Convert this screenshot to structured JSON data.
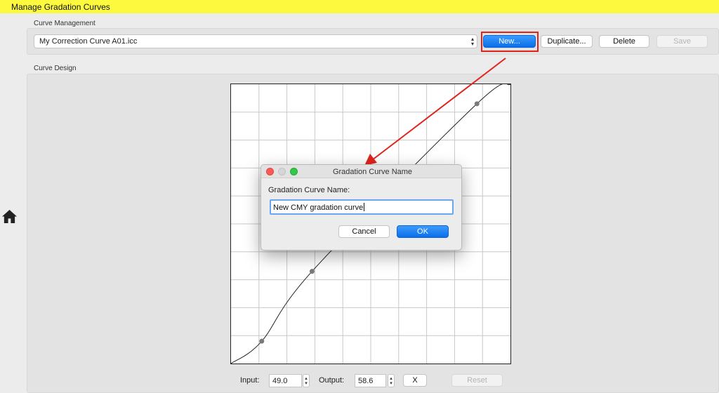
{
  "window": {
    "title": "Manage Gradation Curves"
  },
  "sidebar": {
    "home_icon": "home-icon"
  },
  "curve_management": {
    "section_label": "Curve Management",
    "selected_curve": "My Correction Curve A01.icc",
    "buttons": {
      "new": "New...",
      "duplicate": "Duplicate...",
      "delete": "Delete",
      "save": "Save"
    }
  },
  "curve_design": {
    "section_label": "Curve Design",
    "input_label": "Input:",
    "input_value": "49.0",
    "output_label": "Output:",
    "output_value": "58.6",
    "x_button": "X",
    "reset_button": "Reset",
    "grid_divisions": 10,
    "control_points": [
      {
        "input": 11,
        "output": 8
      },
      {
        "input": 29,
        "output": 33
      },
      {
        "input": 88,
        "output": 93
      }
    ]
  },
  "dialog": {
    "title": "Gradation Curve Name",
    "label": "Gradation Curve Name:",
    "input_value": "New CMY gradation curve",
    "cancel": "Cancel",
    "ok": "OK"
  },
  "colors": {
    "title_bar": "#fdf93f",
    "accent": "#0a6fe8",
    "highlight": "#e0241c"
  }
}
